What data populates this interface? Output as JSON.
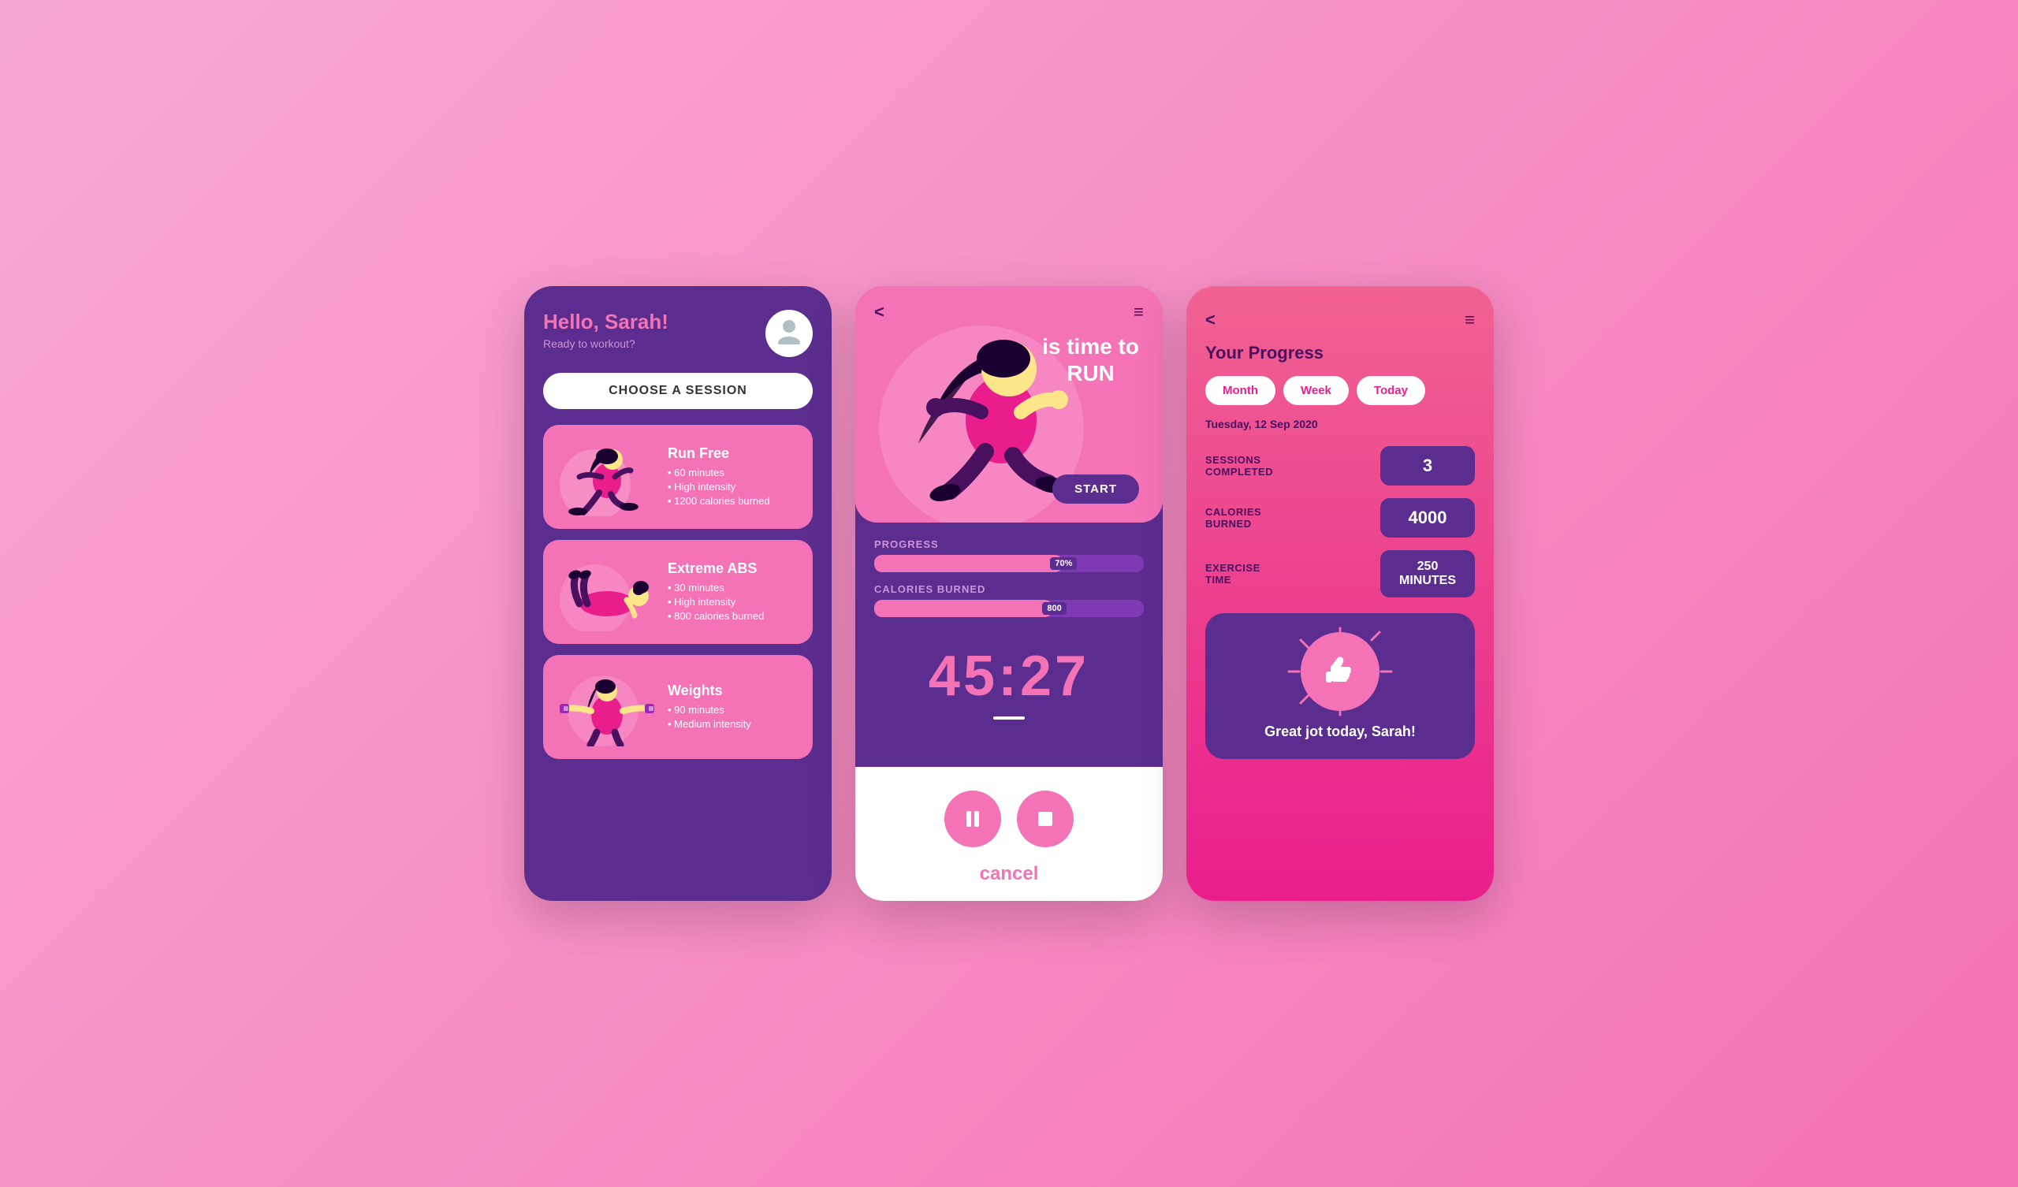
{
  "screen1": {
    "greeting": "Hello, Sarah!",
    "subtitle": "Ready to workout?",
    "choose_btn": "CHOOSE A SESSION",
    "sessions": [
      {
        "name": "Run Free",
        "details": [
          "60 minutes",
          "High intensity",
          "1200 calories burned"
        ],
        "type": "runner"
      },
      {
        "name": "Extreme ABS",
        "details": [
          "30 minutes",
          "High intensity",
          "800 calories burned"
        ],
        "type": "abs"
      },
      {
        "name": "Weights",
        "details": [
          "90 minutes",
          "Medium intensity"
        ],
        "type": "weights"
      }
    ]
  },
  "screen2": {
    "back_icon": "<",
    "menu_icon": "≡",
    "hero_text_line1": "is time to",
    "hero_text_line2": "RUN",
    "start_btn": "START",
    "progress_label": "PROGRESS",
    "progress_pct": "70%",
    "progress_value": 70,
    "calories_label": "CALORIES BURNED",
    "calories_tag": "800",
    "calories_value": 66,
    "timer": "45:27",
    "cancel_btn": "cancel"
  },
  "screen3": {
    "back_icon": "<",
    "menu_icon": "≡",
    "title": "Your Progress",
    "tabs": [
      "Month",
      "Week",
      "Today"
    ],
    "date": "Tuesday, 12 Sep 2020",
    "stats": [
      {
        "label": "SESSIONS\nCOMPLETED",
        "value": "3",
        "small": false
      },
      {
        "label": "CALORIES\nBURNED",
        "value": "4000",
        "small": false
      },
      {
        "label": "EXERCISE\nTIME",
        "value": "250\nMINUTES",
        "small": true
      }
    ],
    "congrats": "Great jot today, Sarah!",
    "thumbs_icon": "👍"
  }
}
